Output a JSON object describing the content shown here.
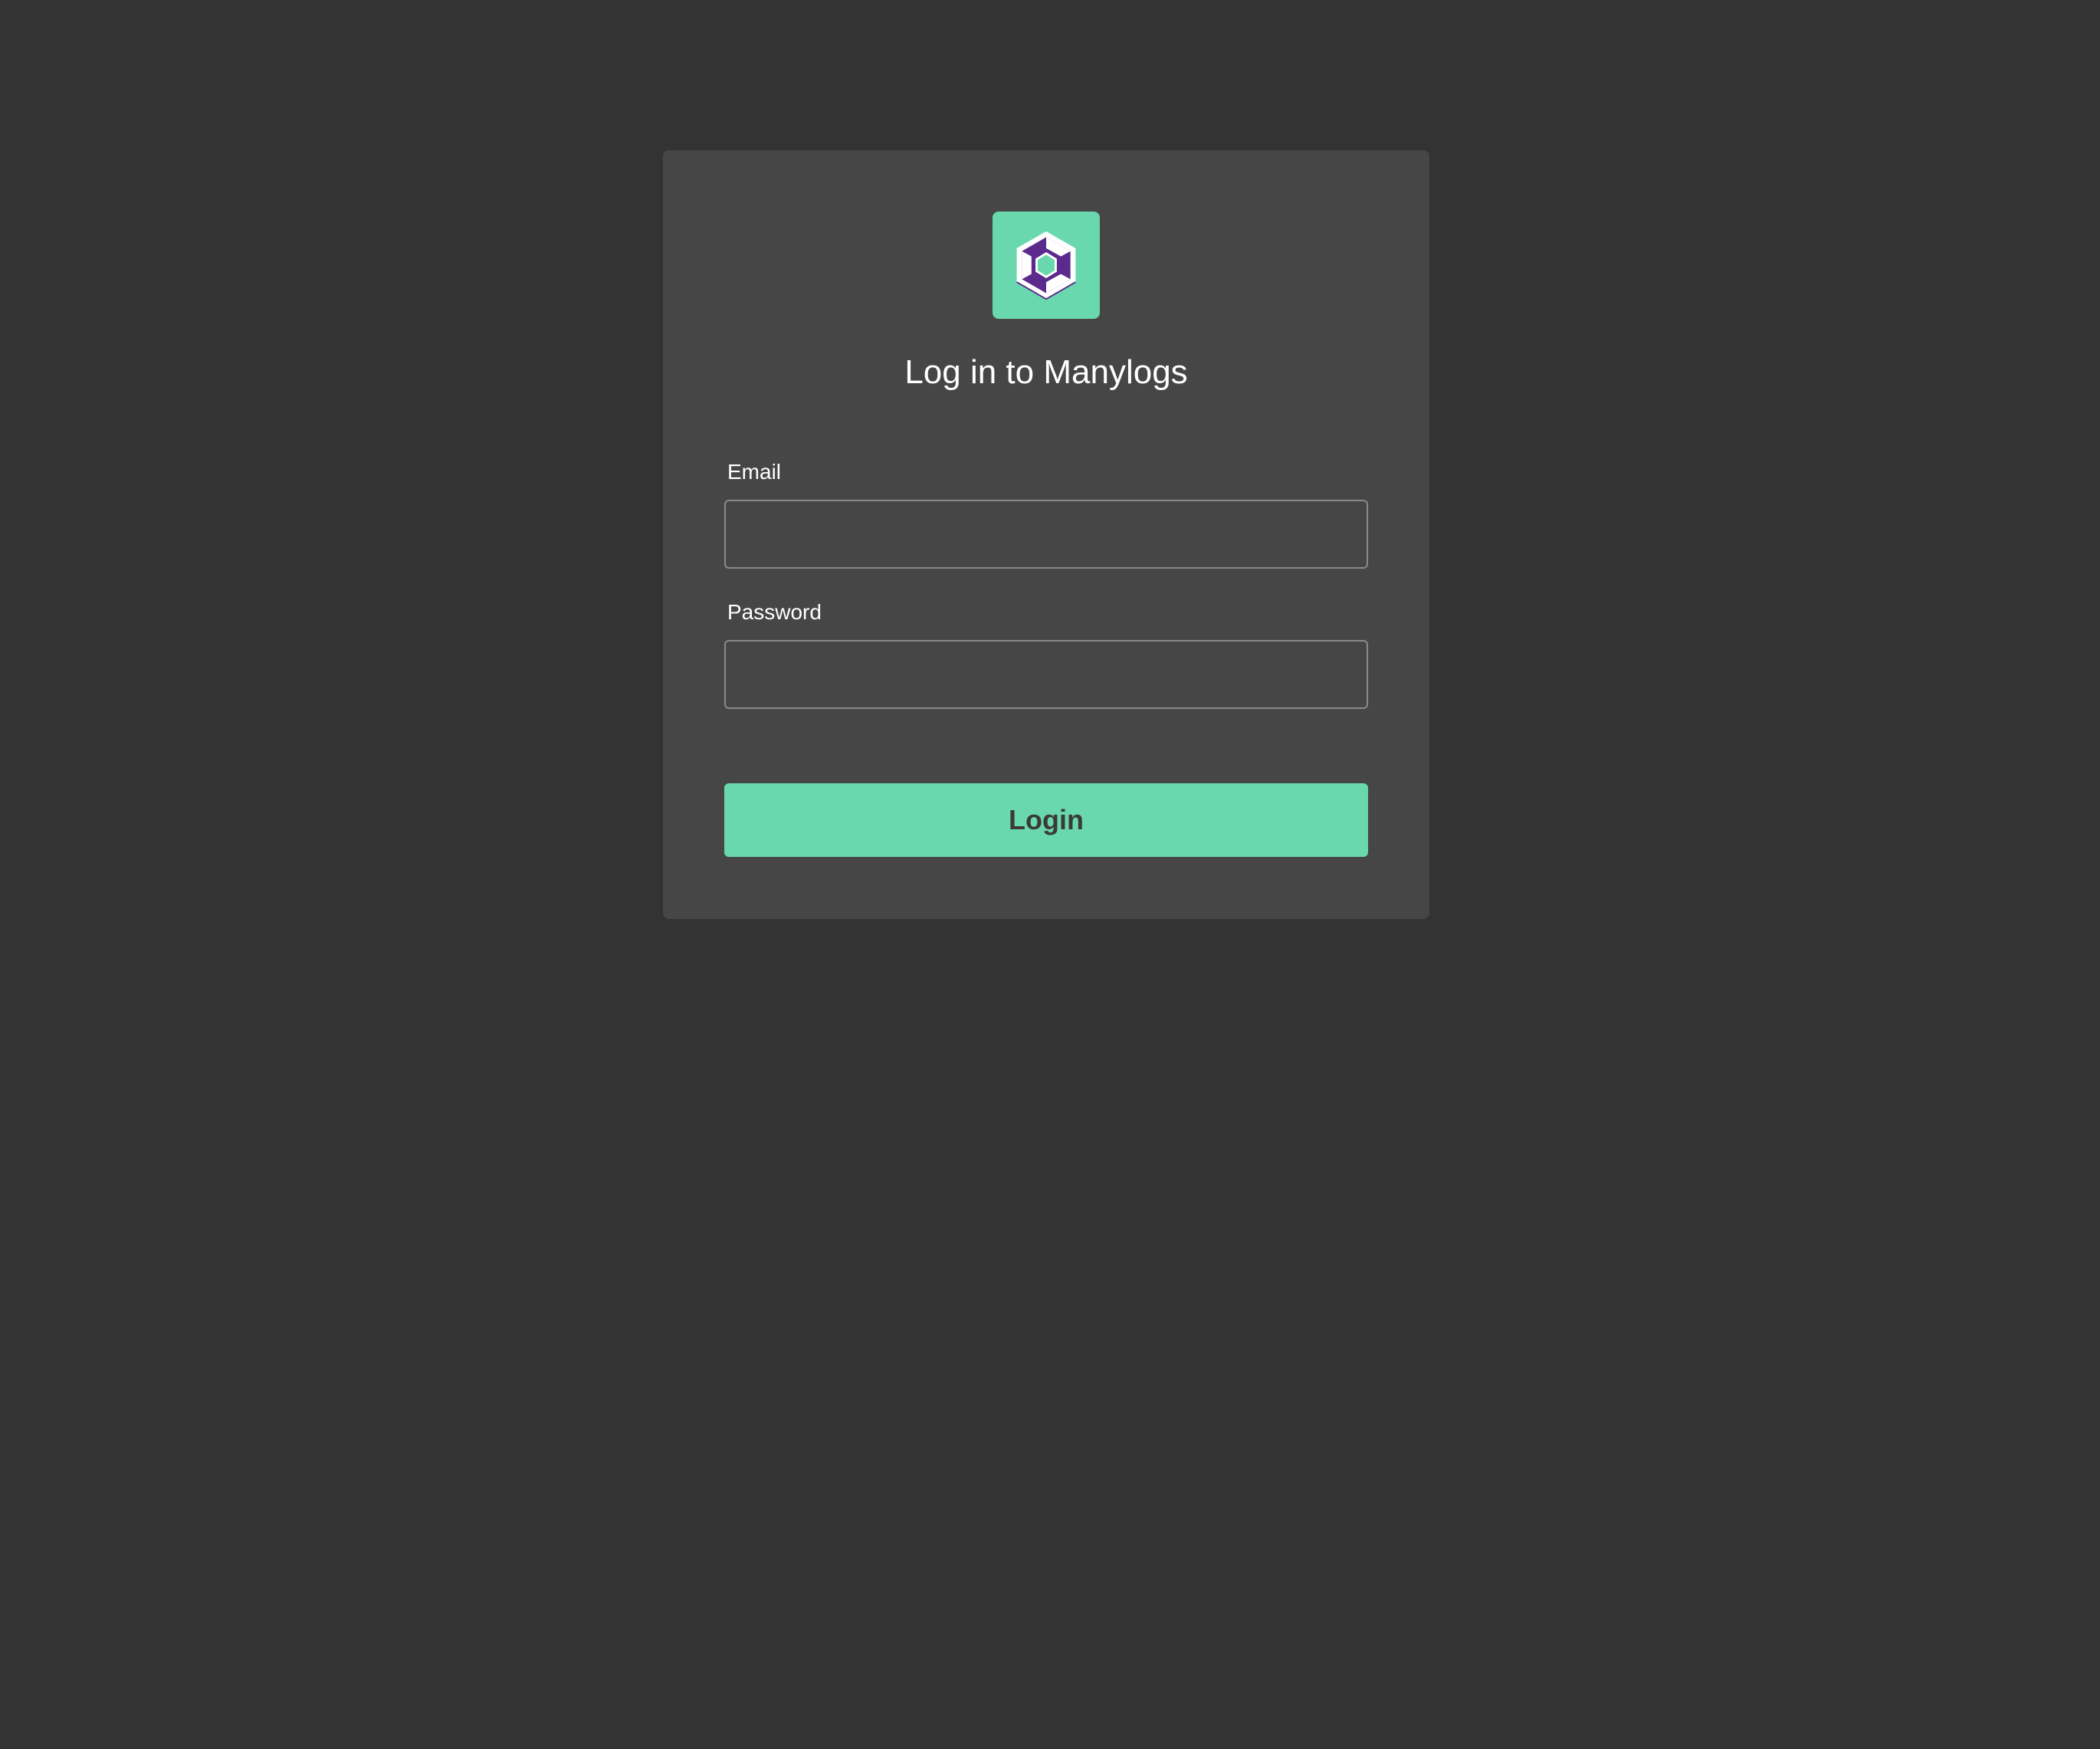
{
  "brand": {
    "logo_icon": "manylogs-hexagon-logo-icon",
    "accent_color": "#6ad8ae",
    "logo_inner_color": "#5b2a8c"
  },
  "login": {
    "title": "Log in to Manylogs",
    "email_label": "Email",
    "email_value": "",
    "password_label": "Password",
    "password_value": "",
    "submit_label": "Login"
  },
  "colors": {
    "page_background": "#333333",
    "card_background": "#464646",
    "input_border": "#8a8a8a"
  }
}
